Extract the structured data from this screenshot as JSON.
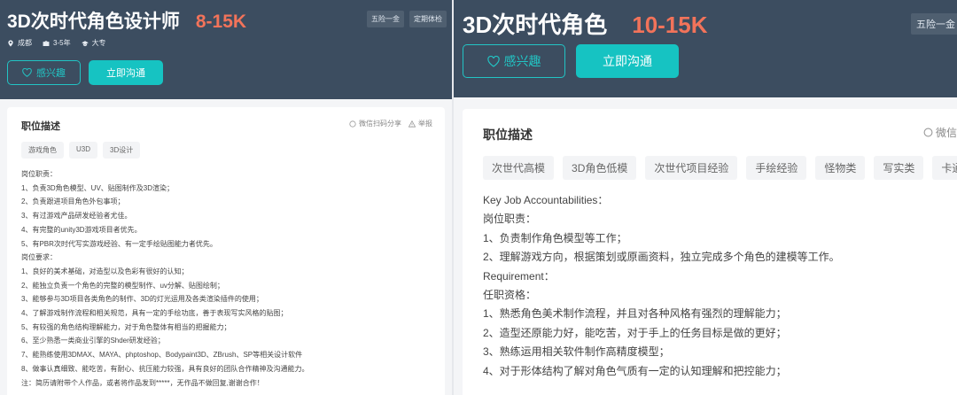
{
  "left": {
    "title": "3D次时代角色设计师",
    "salary": "8-15K",
    "benefits": [
      "五险一金",
      "定期体检"
    ],
    "meta": {
      "city": "成都",
      "experience": "3-5年",
      "education": "大专"
    },
    "buttons": {
      "interest": "感兴趣",
      "chat": "立即沟通"
    },
    "card": {
      "title": "职位描述",
      "actions": {
        "share": "微信扫码分享",
        "report": "举报"
      },
      "tags": [
        "游戏角色",
        "U3D",
        "3D设计"
      ],
      "description": [
        "岗位职责：",
        "1、负责3D角色模型、UV、贴图制作及3D渲染；",
        "2、负责跟进项目角色外包事项；",
        "3、有过游戏产品研发经验者尤佳。",
        "4、有完整的unity3D游戏项目者优先。",
        "5、有PBR次时代写实游戏经验、有一定手绘贴图能力者优先。",
        "岗位要求：",
        "1、良好的美术基础，对造型以及色彩有很好的认知；",
        "2、能独立负责一个角色的完整的模型制作、uv分解、贴图绘制；",
        "3、能够参与3D项目各类角色的制作、3D的灯光运用及各类渲染插件的使用；",
        "4、了解游戏制作流程和相关规范，具有一定的手绘功底，善于表现写实风格的贴图；",
        "5、有较强的角色结构理解能力，对于角色整体有相当的把握能力；",
        "6、至少熟悉一类商业引擎的Shder研发经验；",
        "7、能熟练使用3DMAX、MAYA、phptoshop、Bodypaint3D、ZBrush、SP等相关设计软件",
        "8、做事认真细致、能吃苦，有耐心、抗压能力较强，具有良好的团队合作精神及沟通能力。",
        "注：简历请附带个人作品，或者将作品发到*****，无作品不做回复,谢谢合作！"
      ]
    }
  },
  "right": {
    "title": "3D次时代角色",
    "salary": "10-15K",
    "benefits": [
      "五险一金"
    ],
    "buttons": {
      "interest": "感兴趣",
      "chat": "立即沟通"
    },
    "card": {
      "title": "职位描述",
      "actions": {
        "share": "微信"
      },
      "tags": [
        "次世代高模",
        "3D角色低模",
        "次世代项目经验",
        "手绘经验",
        "怪物类",
        "写实类",
        "卡通类"
      ],
      "description": [
        "Key Job Accountabilities：",
        "岗位职责：",
        "1、负责制作角色模型等工作；",
        "2、理解游戏方向，根据策划或原画资料，独立完成多个角色的建模等工作。",
        "Requirement：",
        "任职资格：",
        "1、熟悉角色美术制作流程，并且对各种风格有强烈的理解能力；",
        "2、造型还原能力好，能吃苦，对于手上的任务目标是做的更好；",
        "3、熟练运用相关软件制作高精度模型；",
        "4、对于形体结构了解对角色气质有一定的认知理解和把控能力；"
      ]
    }
  },
  "colors": {
    "header_bg": "#3c4d60",
    "salary": "#f2735a",
    "accent": "#16c3c2"
  },
  "icons": {
    "location": "location-icon",
    "experience": "briefcase-icon",
    "education": "graduation-cap-icon",
    "interest": "heart-icon",
    "share": "wechat-circle-icon",
    "report": "warning-icon"
  }
}
